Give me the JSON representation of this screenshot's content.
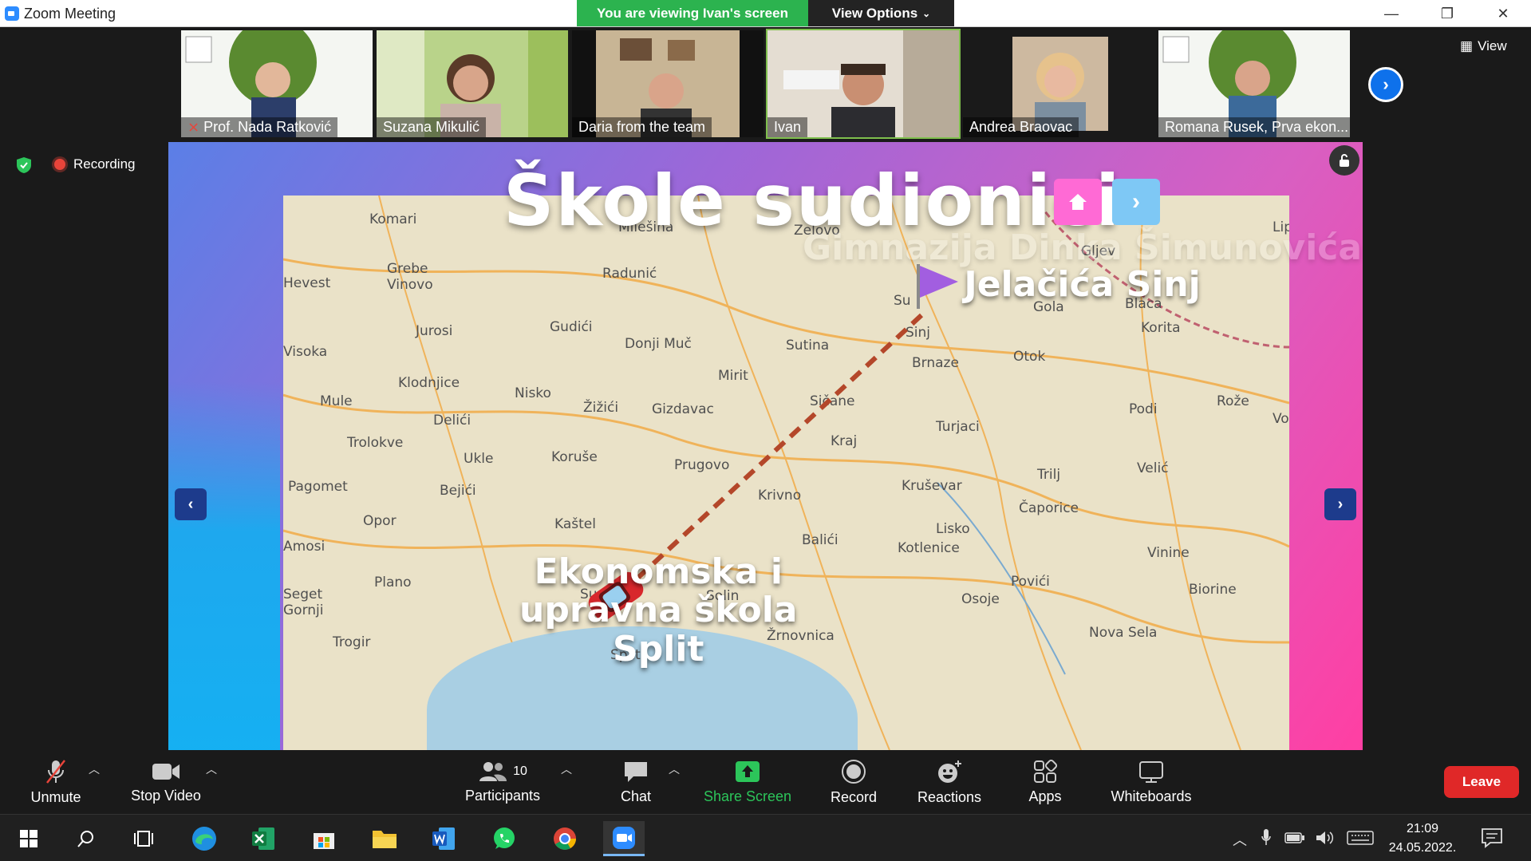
{
  "window": {
    "title": "Zoom Meeting",
    "minimize": "—",
    "restore": "❐",
    "close": "✕"
  },
  "banner": {
    "viewing": "You are viewing Ivan's screen",
    "view_options": "View Options"
  },
  "participants_strip": [
    {
      "name": "Prof. Nada Ratković",
      "muted": true,
      "color": "#6a8f3a"
    },
    {
      "name": "Suzana Mikulić",
      "muted": false,
      "color": "#8aaa55"
    },
    {
      "name": "Daria from the team",
      "muted": false,
      "color": "#bda88a"
    },
    {
      "name": "Ivan",
      "muted": false,
      "color": "#d6ccc0",
      "active": true
    },
    {
      "name": "Andrea Braovac",
      "muted": false,
      "color": "#c9b59a"
    },
    {
      "name": "Romana Rusek, Prva ekon...",
      "muted": false,
      "color": "#6a8f3a"
    }
  ],
  "view_button": "View",
  "status": {
    "recording": "Recording"
  },
  "slide": {
    "title": "Škole sudionici",
    "destination": [
      "Gimnazija Dinka Šimunovića Sinj",
      "Jelačića Sinj"
    ],
    "destination_top": "Gimnazija Dinka Šimunovića",
    "destination_bottom": "Jelačića Sinj",
    "origin": [
      "Ekonomska i",
      "upravna škola",
      "Split"
    ],
    "places": [
      "Komari",
      "Milešina",
      "Zelovo",
      "Gljev",
      "Lip",
      "Hevest",
      "Grebe Vinovo",
      "Radunić",
      "Jurosi",
      "Gudići",
      "Sutina",
      "Su",
      "Sinj",
      "Gola",
      "Blaca",
      "Korita",
      "Visoka",
      "Donji Muč",
      "Otok",
      "Brnaze",
      "Mirit",
      "Klodnjice",
      "Mule",
      "Nisko",
      "Žižići",
      "Gizdavac",
      "Sičane",
      "Podi",
      "Rože",
      "Delići",
      "Turjaci",
      "Trolokve",
      "Ukle",
      "Koruše",
      "Kraj",
      "Velić",
      "Prugovo",
      "Trilj",
      "Pagomet",
      "Bejići",
      "Kaštel",
      "Krivno",
      "Kruševar",
      "Čaporice",
      "Opor",
      "Lisko",
      "Vinine",
      "Balići",
      "Kotlenice",
      "Povići",
      "Biorine",
      "Plano",
      "Sucurac",
      "Solin",
      "Osoje",
      "Seget Gornji",
      "Trogir",
      "Žrnovnica",
      "Nova Sela",
      "Split",
      "Amosi",
      "Vo"
    ]
  },
  "toolbar": {
    "unmute": "Unmute",
    "stop_video": "Stop Video",
    "participants": "Participants",
    "participant_count": "10",
    "chat": "Chat",
    "share_screen": "Share Screen",
    "record": "Record",
    "reactions": "Reactions",
    "apps": "Apps",
    "whiteboards": "Whiteboards",
    "leave": "Leave"
  },
  "taskbar": {
    "apps": [
      "start-icon",
      "search-icon",
      "task-view-icon",
      "edge-icon",
      "excel-icon",
      "store-icon",
      "file-explorer-icon",
      "word-icon",
      "whatsapp-icon",
      "chrome-icon",
      "zoom-icon"
    ],
    "time": "21:09",
    "date": "24.05.2022."
  }
}
